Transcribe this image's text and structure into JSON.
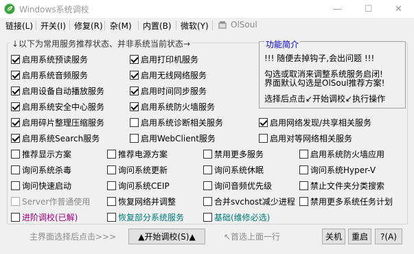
{
  "window": {
    "title": "Windows系统调校",
    "minimize": "—",
    "maximize": "☐",
    "close": "✕"
  },
  "menu": {
    "items": [
      "链接(L)",
      "开关(I)",
      "修复(R)",
      "杂(M)",
      "内置(B)",
      "微软(Y)",
      "OlSoul"
    ]
  },
  "group": {
    "title": "↓以下为常用服务推荐状态、并非系统当前状态→"
  },
  "info": {
    "title": "功能简介",
    "line1": "!!! 随便去掉钩子,会出问题 !!!",
    "line2": "勾选或取消来调整系统服务启闭!",
    "line3": "界面默认勾选是OlSoul推荐方案!",
    "line4": "选择后点击↙开始调校↙执行操作"
  },
  "checkboxes": {
    "c1": "启用系统预读服务",
    "c2": "启用系统音频服务",
    "c3": "启用设备自动播放服务",
    "c4": "启用系统安全中心服务",
    "c5": "启用碎片整理压缩服务",
    "c6": "启用系统Search服务",
    "c7": "启用打印机服务",
    "c8": "启用无线网络服务",
    "c9": "启用时间同步服务",
    "c10": "启用系统防火墙服务",
    "c11": "启用系统诊断相关服务",
    "c12": "启用WebClient服务",
    "c13": "启用网络发现/共享相关服务",
    "c14": "启用对等网络相关服务",
    "r1": "推荐显示方案",
    "r2": "推荐电源方案",
    "r3": "禁用更多服务",
    "r4": "启用系统防火墙应用",
    "r5": "询问系统杀毒",
    "r6": "询问系统更新",
    "r7": "询问系统休眠",
    "r8": "询问系统Hyper-V",
    "r9": "询问快速启动",
    "r10": "询问系统CEIP",
    "r11": "询问音频优先级",
    "r12": "禁止文件夹分类搜索",
    "r13": "Server作普通使用",
    "r14": "恢复网络并调整",
    "r15": "合并svchost减少进程",
    "r16": "禁用更多系统任务计划",
    "p1": "进阶调校(已解)",
    "p2": "恢复部分系统服务",
    "p3": "基础(维修必选)"
  },
  "bottom": {
    "hint_left": "主界面选择后点击>>>",
    "start_button": "▲开始调校(S)▲",
    "hint_right": "↖首选上面一行",
    "shutdown_button": "关机",
    "restart_button": "重启",
    "help_button": "?(A)"
  },
  "colors": {
    "accent_blue": "#0000cc",
    "purple_text": "#9b0080",
    "teal_text": "#007b7b",
    "disabled_text": "#8a8a8a"
  }
}
